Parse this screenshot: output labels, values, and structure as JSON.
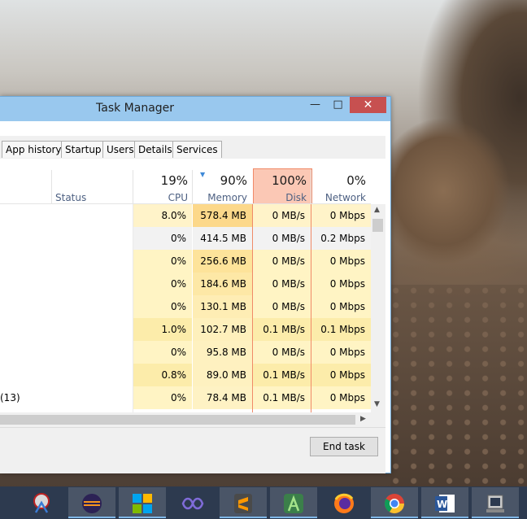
{
  "window": {
    "title": "Task Manager",
    "controls": {
      "minimize": "—",
      "maximize": "□",
      "close": "✕"
    }
  },
  "tabs": [
    "App history",
    "Startup",
    "Users",
    "Details",
    "Services"
  ],
  "columns": {
    "status": {
      "label": "Status"
    },
    "cpu": {
      "percent": "19%",
      "label": "CPU"
    },
    "memory": {
      "percent": "90%",
      "label": "Memory",
      "sorted": true
    },
    "disk": {
      "percent": "100%",
      "label": "Disk",
      "highlight_color": "#fbc8b5"
    },
    "network": {
      "percent": "0%",
      "label": "Network"
    }
  },
  "rows": [
    {
      "name": "",
      "cpu": "8.0%",
      "memory": "578.4 MB",
      "disk": "0 MB/s",
      "network": "0 Mbps",
      "bg": "#fff3c9",
      "mem_bg": "#fcd88a"
    },
    {
      "name": "",
      "cpu": "0%",
      "memory": "414.5 MB",
      "disk": "0 MB/s",
      "network": "0.2 Mbps",
      "bg": "#f2f2f2",
      "mem_bg": "#f2f2f2"
    },
    {
      "name": "",
      "cpu": "0%",
      "memory": "256.6 MB",
      "disk": "0 MB/s",
      "network": "0 Mbps",
      "bg": "#fff4c4",
      "mem_bg": "#fde39a"
    },
    {
      "name": "",
      "cpu": "0%",
      "memory": "184.6 MB",
      "disk": "0 MB/s",
      "network": "0 Mbps",
      "bg": "#fff4c4",
      "mem_bg": "#fde8a6"
    },
    {
      "name": "",
      "cpu": "0%",
      "memory": "130.1 MB",
      "disk": "0 MB/s",
      "network": "0 Mbps",
      "bg": "#fff4c4",
      "mem_bg": "#feedb4"
    },
    {
      "name": "",
      "cpu": "1.0%",
      "memory": "102.7 MB",
      "disk": "0.1 MB/s",
      "network": "0.1 Mbps",
      "bg": "#fcecaa",
      "mem_bg": "#fef0bc"
    },
    {
      "name": "",
      "cpu": "0%",
      "memory": "95.8 MB",
      "disk": "0 MB/s",
      "network": "0 Mbps",
      "bg": "#fff4c4",
      "mem_bg": "#fef1c0"
    },
    {
      "name": "",
      "cpu": "0.8%",
      "memory": "89.0 MB",
      "disk": "0.1 MB/s",
      "network": "0 Mbps",
      "bg": "#fcecaa",
      "mem_bg": "#fef1c0"
    },
    {
      "name": "(13)",
      "cpu": "0%",
      "memory": "78.4 MB",
      "disk": "0.1 MB/s",
      "network": "0 Mbps",
      "bg": "#fff4c4",
      "mem_bg": "#fef2c4"
    }
  ],
  "footer": {
    "end_task": "End task"
  },
  "taskbar": [
    {
      "icon": "snipping-tool-icon"
    },
    {
      "icon": "eclipse-icon",
      "active": true
    },
    {
      "icon": "windows-store-icon",
      "active": true
    },
    {
      "icon": "visual-studio-icon"
    },
    {
      "icon": "sublime-text-icon",
      "active": true
    },
    {
      "icon": "android-studio-icon",
      "active": true
    },
    {
      "icon": "firefox-icon"
    },
    {
      "icon": "chrome-icon",
      "active": true
    },
    {
      "icon": "word-icon",
      "active": true
    },
    {
      "icon": "task-manager-icon",
      "active": true
    }
  ]
}
